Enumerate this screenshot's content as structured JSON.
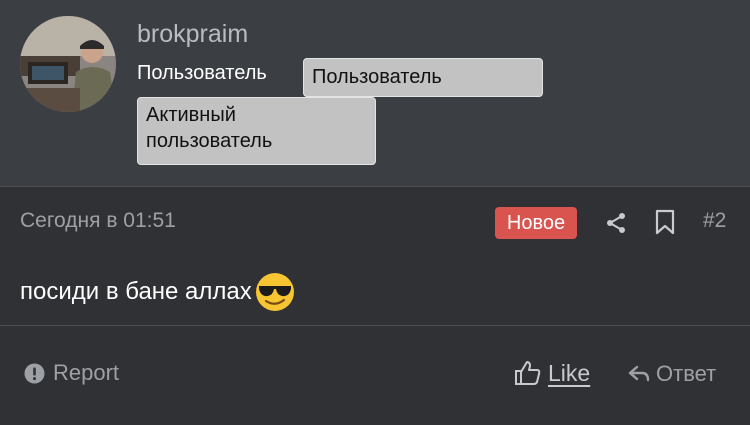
{
  "user": {
    "username": "brokpraim",
    "role_label": "Пользователь",
    "badges": [
      "Пользователь",
      "Активный\nпользователь"
    ]
  },
  "post": {
    "date": "Сегодня в 01:51",
    "new_badge": "Новое",
    "number": "#2",
    "message": "посиди в бане аллах",
    "emoji": "smiling-face-with-sunglasses"
  },
  "actions": {
    "report": "Report",
    "like": "Like",
    "reply": "Ответ"
  },
  "colors": {
    "background": "#2f3135",
    "header_background": "#3b3e43",
    "new_badge": "#d9534f",
    "badge_background": "#c2c2c2"
  }
}
